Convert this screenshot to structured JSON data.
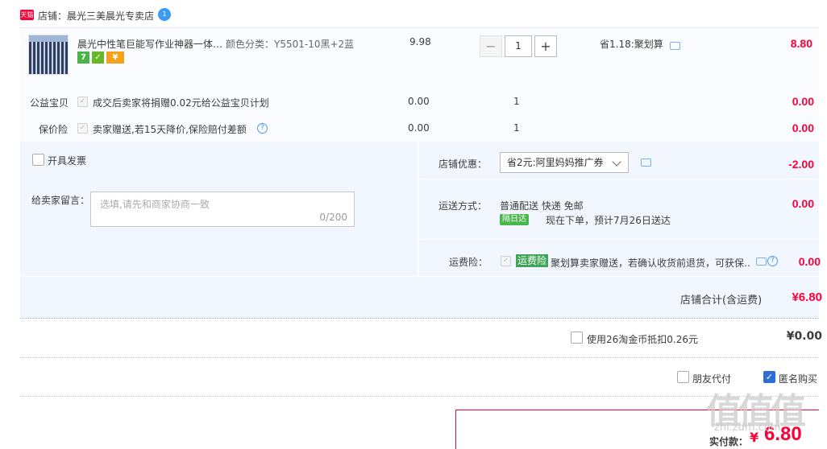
{
  "shop": {
    "badge": "天猫",
    "name": "店铺：晨光三美晨光专卖店",
    "ww_badge": "1"
  },
  "item": {
    "title": "晨光中性笔巨能写作业神器一体…",
    "sku": "颜色分类：Y5501-10黑+2蓝",
    "price": "9.98",
    "qty": "1",
    "qty_minus": "−",
    "qty_plus": "+",
    "discount": "省1.18:聚划算",
    "subtotal": "8.80",
    "svc_icons": [
      "7",
      "✓",
      "¥"
    ]
  },
  "charity": {
    "label": "公益宝贝",
    "text": "成交后卖家将捐赠0.02元给公益宝贝计划",
    "price": "0.00",
    "qty": "1",
    "total": "0.00"
  },
  "insurance": {
    "label": "保价险",
    "text": "卖家赠送,若15天降价,保险赔付差额",
    "price": "0.00",
    "qty": "1",
    "total": "0.00"
  },
  "invoice": {
    "label": "开具发票"
  },
  "message": {
    "label": "给卖家留言：",
    "placeholder": "选填,请先和商家协商一致",
    "count": "0/200"
  },
  "shop_discount": {
    "label": "店铺优惠：",
    "selected": "省2元:阿里妈妈推广券",
    "amount": "-2.00"
  },
  "delivery": {
    "label": "运送方式：",
    "method": "普通配送 快递 免邮",
    "tag": "隔日达",
    "eta": "现在下单，预计7月26日送达",
    "amount": "0.00"
  },
  "freight_ins": {
    "label": "运费险：",
    "tag": "运费险",
    "text": "聚划算卖家赠送，若确认收货前退货，可获保…",
    "amount": "0.00"
  },
  "shop_total": {
    "label": "店铺合计(含运费)",
    "amount": "¥6.80"
  },
  "coins": {
    "label": "使用26淘金币抵扣0.26元",
    "amount": "¥0.00"
  },
  "friend_pay": {
    "label": "朋友代付"
  },
  "anonymous": {
    "label": "匿名购买"
  },
  "payment": {
    "label": "实付款：",
    "currency": "¥",
    "amount": "6.80"
  },
  "watermark": {
    "logo": "值值值",
    "site": "zhi.zdm.com"
  }
}
